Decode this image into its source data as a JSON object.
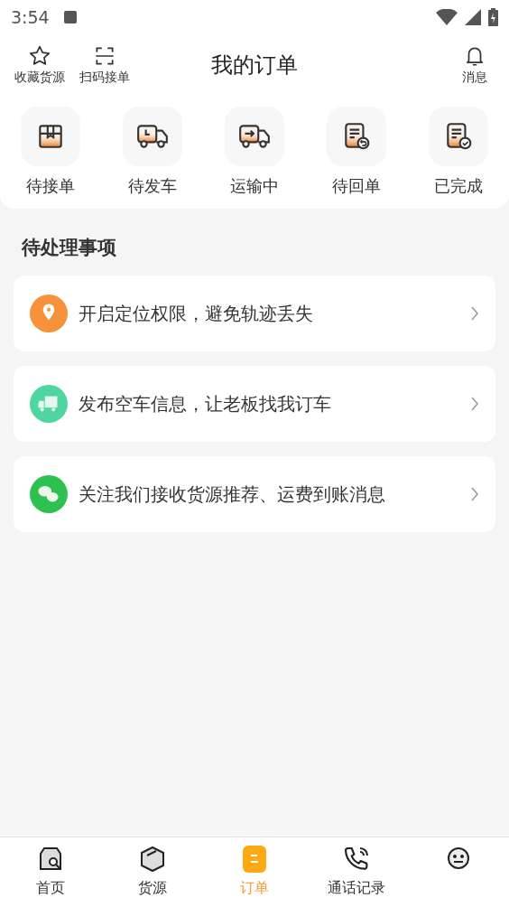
{
  "status_bar": {
    "time": "3:54"
  },
  "header": {
    "title": "我的订单",
    "left_actions": [
      {
        "kind": "star",
        "label": "收藏货源"
      },
      {
        "kind": "scan",
        "label": "扫码接单"
      }
    ],
    "right_action": {
      "kind": "bell",
      "label": "消息"
    }
  },
  "order_states": [
    {
      "kind": "box",
      "label": "待接单"
    },
    {
      "kind": "truck-clock",
      "label": "待发车"
    },
    {
      "kind": "truck-arrow",
      "label": "运输中"
    },
    {
      "kind": "doc-return",
      "label": "待回单"
    },
    {
      "kind": "doc-check",
      "label": "已完成"
    }
  ],
  "todo": {
    "title": "待处理事项",
    "items": [
      {
        "kind": "location",
        "color": "#f7923a",
        "text": "开启定位权限，避免轨迹丢失"
      },
      {
        "kind": "truck",
        "color": "#4fd6a0",
        "text": "发布空车信息，让老板找我订车"
      },
      {
        "kind": "wechat",
        "color": "#2fc14f",
        "text": "关注我们接收货源推荐、运费到账消息"
      }
    ]
  },
  "tab_bar": [
    {
      "kind": "home",
      "label": "首页",
      "selected": false
    },
    {
      "kind": "cube",
      "label": "货源",
      "selected": false
    },
    {
      "kind": "order",
      "label": "订单",
      "selected": true
    },
    {
      "kind": "phone",
      "label": "通话记录",
      "selected": false
    },
    {
      "kind": "face",
      "selected": false
    }
  ]
}
